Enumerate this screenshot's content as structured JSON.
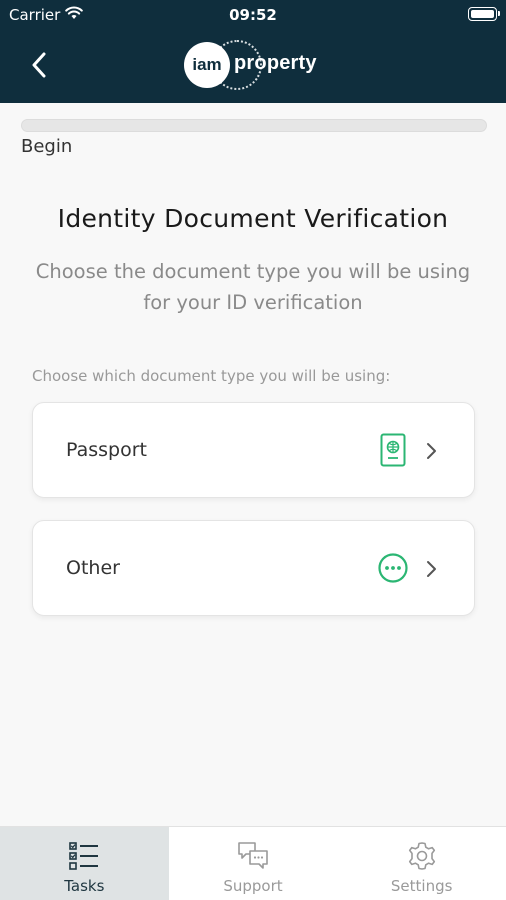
{
  "status_bar": {
    "carrier": "Carrier",
    "time": "09:52"
  },
  "header": {
    "logo_mark": "iam",
    "logo_text": "property",
    "background_color": "#0f2e3d"
  },
  "progress": {
    "label": "Begin",
    "value": 0
  },
  "main": {
    "title": "Identity Document Verification",
    "subtitle": "Choose the document type you will be using for your ID verification",
    "section_label": "Choose which document type you will be using:",
    "options": [
      {
        "label": "Passport",
        "icon": "passport-icon"
      },
      {
        "label": "Other",
        "icon": "more-circle-icon"
      }
    ],
    "accent_color": "#2bb673"
  },
  "tabbar": {
    "tabs": [
      {
        "label": "Tasks",
        "icon": "tasks-checklist-icon",
        "active": true
      },
      {
        "label": "Support",
        "icon": "chat-bubbles-icon",
        "active": false
      },
      {
        "label": "Settings",
        "icon": "gear-icon",
        "active": false
      }
    ]
  }
}
